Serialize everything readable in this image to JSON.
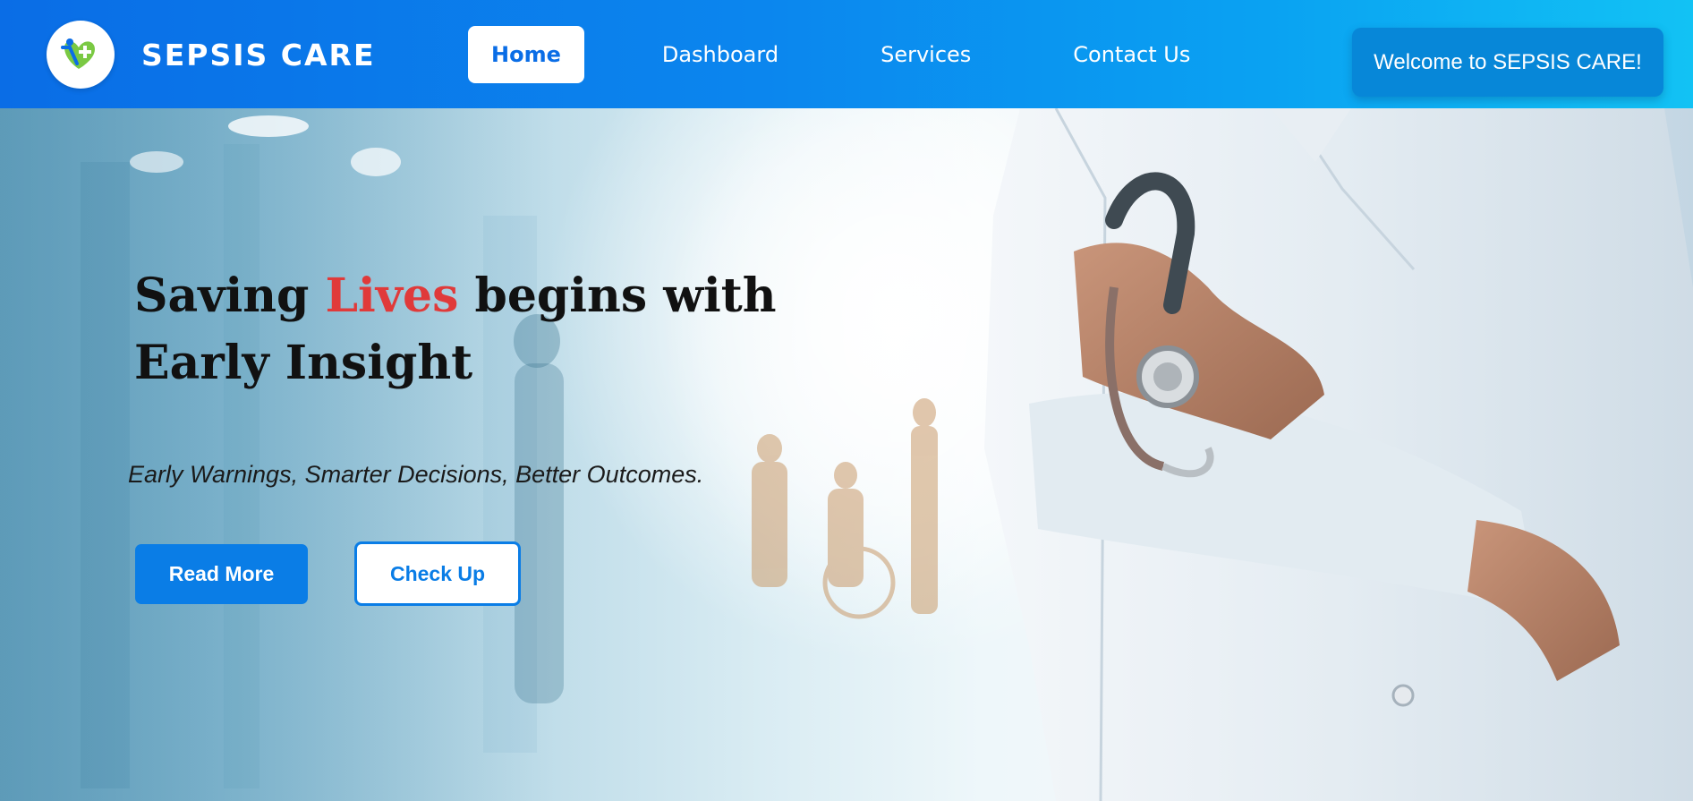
{
  "brand": {
    "name": "SEPSIS CARE",
    "logo_icon": "heart-cross-person-icon"
  },
  "nav": {
    "items": [
      {
        "label": "Home",
        "active": true
      },
      {
        "label": "Dashboard",
        "active": false
      },
      {
        "label": "Services",
        "active": false
      },
      {
        "label": "Contact Us",
        "active": false
      }
    ],
    "welcome_label": "Welcome to SEPSIS CARE!"
  },
  "hero": {
    "headline_part1": "Saving ",
    "headline_accent": "Lives",
    "headline_part2": " begins with Early Insight",
    "subline": "Early Warnings, Smarter Decisions, Better Outcomes.",
    "primary_button": "Read More",
    "secondary_button": "Check Up",
    "background_image": "doctor-with-stethoscope-hospital-corridor"
  },
  "colors": {
    "nav_gradient_start": "#0a6de6",
    "nav_gradient_end": "#12c2f4",
    "accent_red": "#e03a3a",
    "button_blue": "#0a7de6",
    "welcome_bg": "#0787d8"
  }
}
